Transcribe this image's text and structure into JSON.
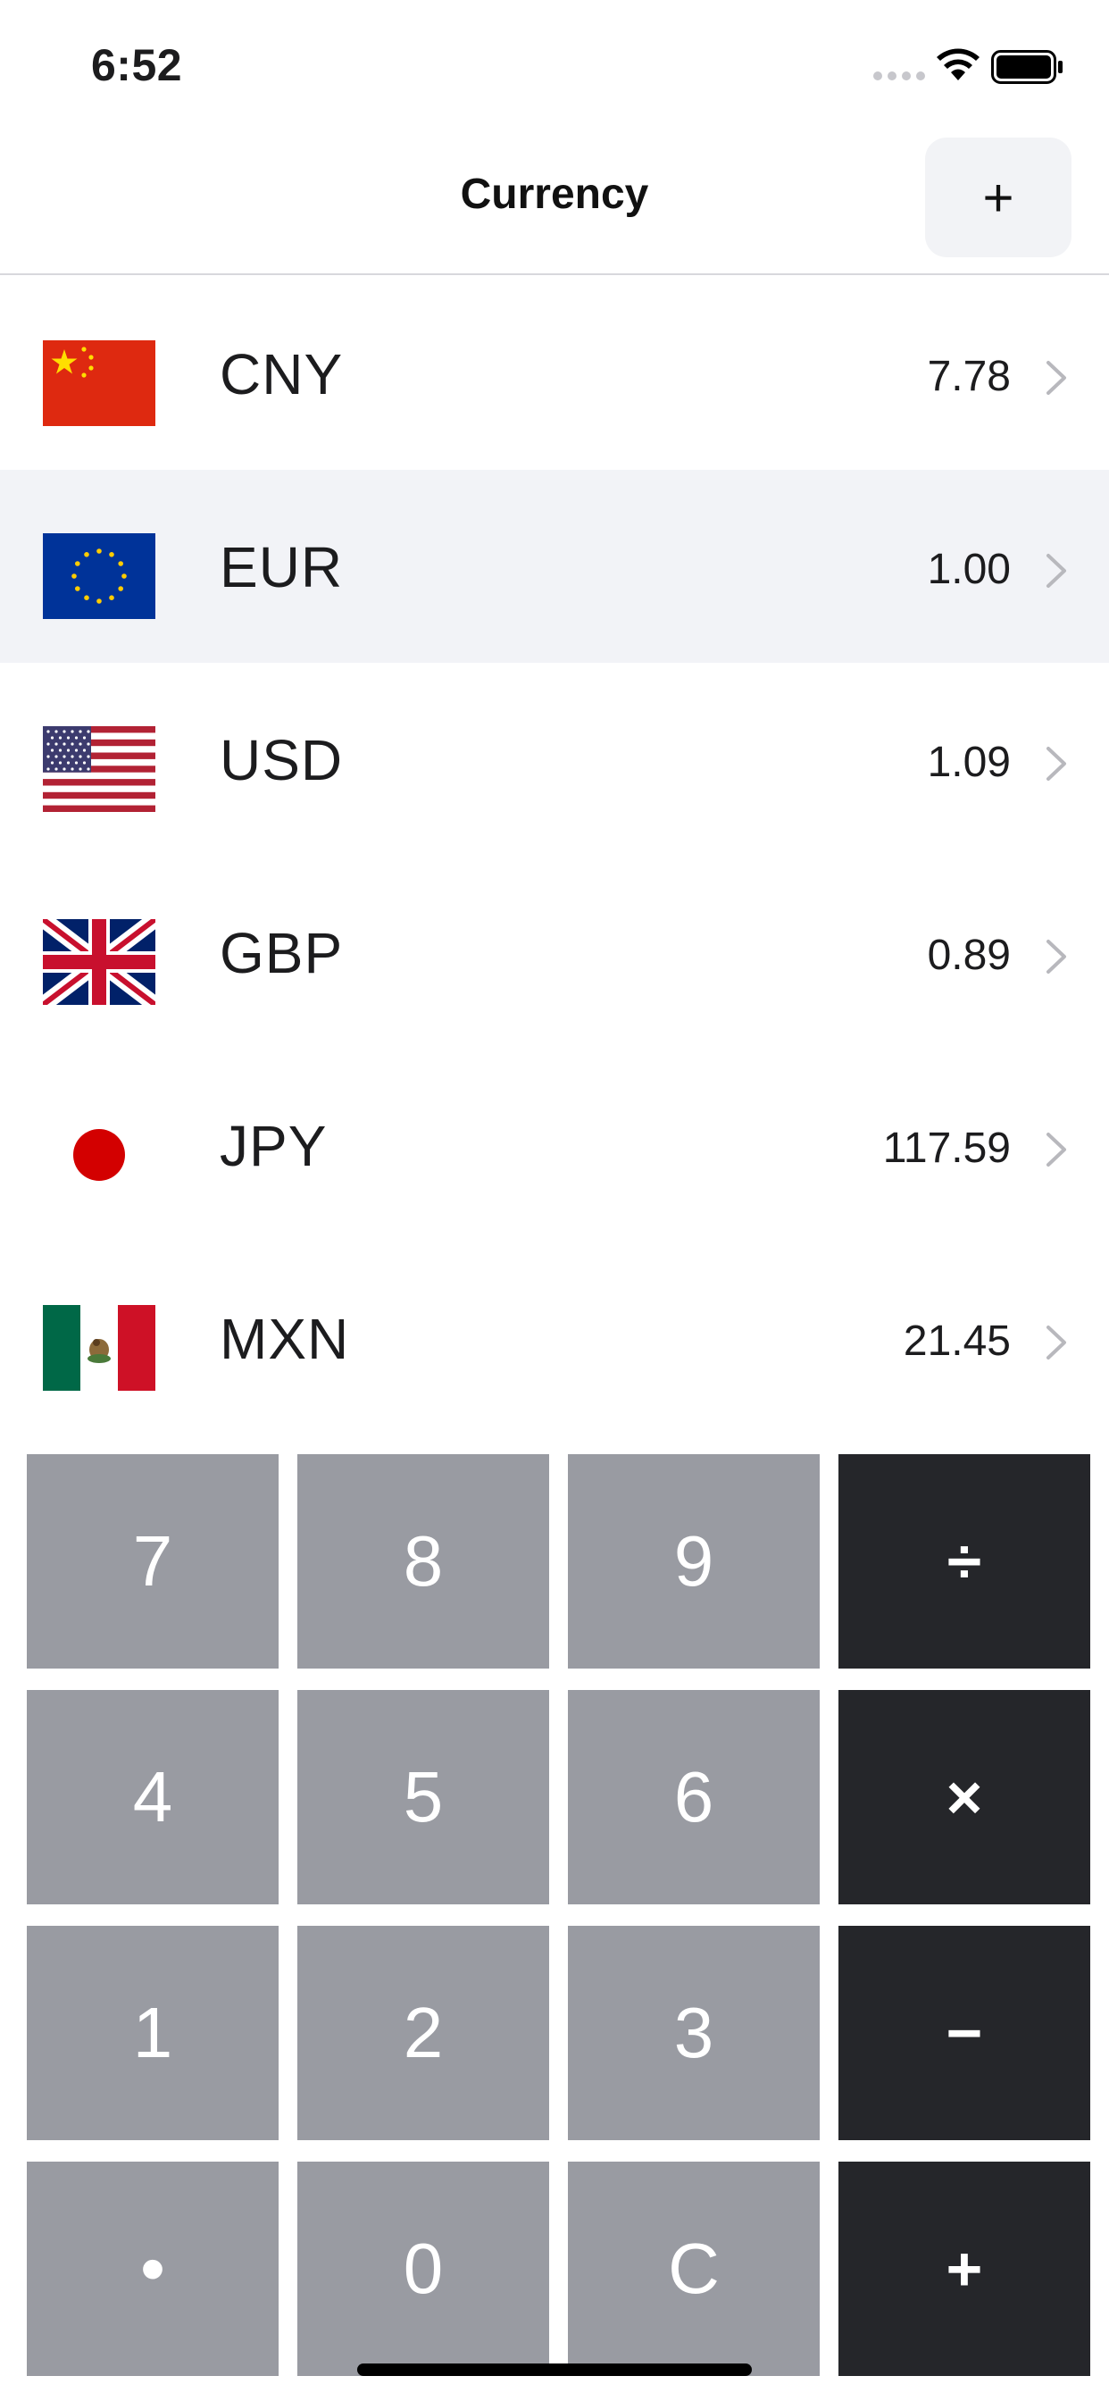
{
  "status_bar": {
    "time": "6:52"
  },
  "nav": {
    "title": "Currency",
    "add_label": "+"
  },
  "currencies": [
    {
      "code": "CNY",
      "rate": "7.78",
      "flag": "china-flag-icon",
      "selected": false
    },
    {
      "code": "EUR",
      "rate": "1.00",
      "flag": "eu-flag-icon",
      "selected": true
    },
    {
      "code": "USD",
      "rate": "1.09",
      "flag": "usa-flag-icon",
      "selected": false
    },
    {
      "code": "GBP",
      "rate": "0.89",
      "flag": "uk-flag-icon",
      "selected": false
    },
    {
      "code": "JPY",
      "rate": "117.59",
      "flag": "japan-flag-icon",
      "selected": false
    },
    {
      "code": "MXN",
      "rate": "21.45",
      "flag": "mexico-flag-icon",
      "selected": false
    }
  ],
  "keypad": {
    "keys": [
      [
        "7",
        "8",
        "9",
        "÷"
      ],
      [
        "4",
        "5",
        "6",
        "×"
      ],
      [
        "1",
        "2",
        "3",
        "−"
      ],
      [
        "•",
        "0",
        "C",
        "+"
      ]
    ]
  },
  "colors": {
    "number_key": "#999ba2",
    "operator_key": "#25262a",
    "selected_row": "#f2f3f7",
    "add_button_bg": "#f2f3f6"
  }
}
